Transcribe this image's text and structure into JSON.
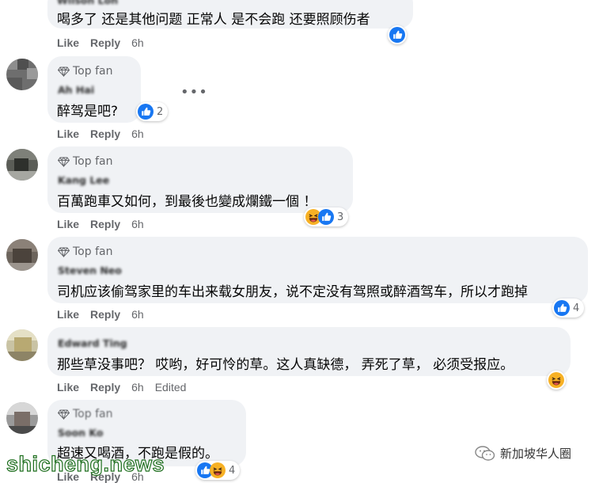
{
  "actions": {
    "like": "Like",
    "reply": "Reply"
  },
  "comments": [
    {
      "badge": "",
      "name": "Wilson Loh",
      "text": "喝多了 还是其他问题 正常人 是不会跑 还要照顾伤者",
      "time": "6h",
      "edited": "",
      "reactions": [
        "like"
      ],
      "count": ""
    },
    {
      "badge": "Top fan",
      "name": "Ah Hai",
      "text": "醉驾是吧?",
      "time": "6h",
      "edited": "",
      "reactions": [
        "like"
      ],
      "count": "2"
    },
    {
      "badge": "Top fan",
      "name": "Kang Lee",
      "text": "百萬跑車又如何，到最後也變成爛鐵一個 ！",
      "time": "6h",
      "edited": "",
      "reactions": [
        "haha",
        "like"
      ],
      "count": "3"
    },
    {
      "badge": "Top fan",
      "name": "Steven Neo",
      "text": "司机应该偷驾家里的车出来载女朋友，说不定没有驾照或醉酒驾车，所以才跑掉",
      "time": "6h",
      "edited": "",
      "reactions": [
        "like"
      ],
      "count": "4"
    },
    {
      "badge": "",
      "name": "Edward Ting",
      "text": "那些草没事吧？ 哎哟，好可怜的草。这人真缺德， 弄死了草， 必须受报应。",
      "time": "6h",
      "edited": "Edited",
      "reactions": [
        "haha"
      ],
      "count": ""
    },
    {
      "badge": "Top fan",
      "name": "Soon Ko",
      "text": "超速又喝酒，不跑是假的。",
      "time": "6h",
      "edited": "",
      "reactions": [
        "like",
        "haha"
      ],
      "count": "4"
    }
  ],
  "more_label": "•••",
  "watermark": {
    "left": "shicheng.news",
    "right": "新加坡华人圈"
  },
  "colors": {
    "like_blue": "#1877f2",
    "haha_yellow": "#f7b125",
    "bubble": "#f0f2f5",
    "meta_gray": "#65676b"
  }
}
